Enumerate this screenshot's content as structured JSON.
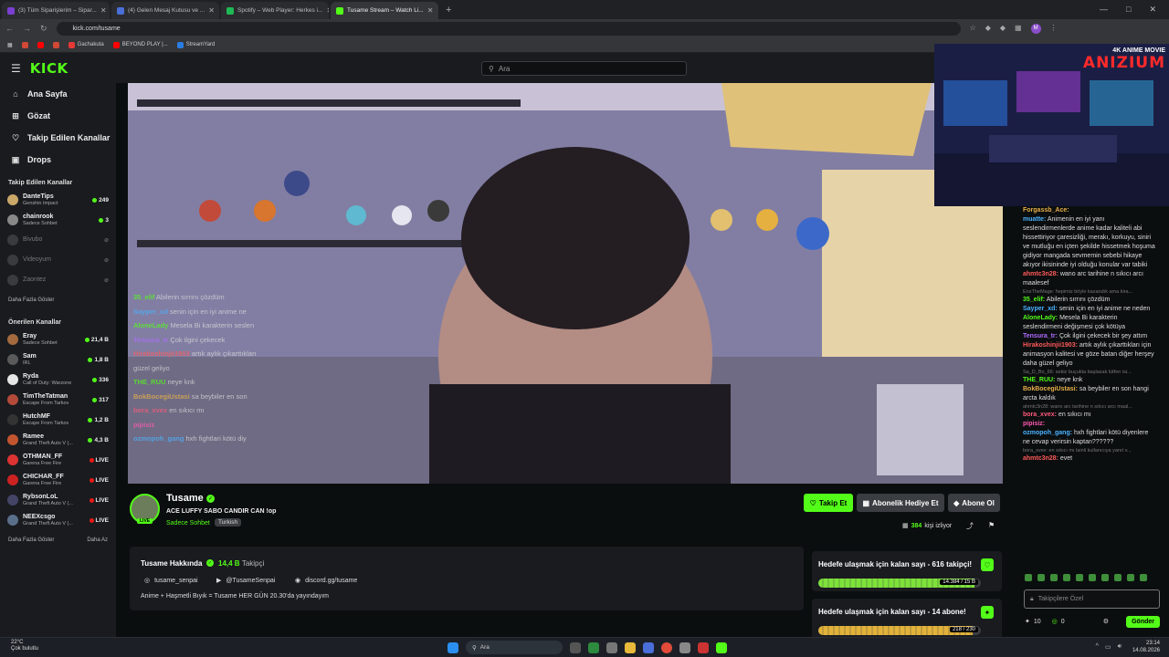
{
  "browser": {
    "tabs": [
      {
        "label": "(3) Tüm Siparişlerim – Sipar...",
        "color": "#7a3fd1",
        "active": false
      },
      {
        "label": "(4) Gelen Mesaj Kutusu ve ...",
        "color": "#4a6fd8",
        "active": false
      },
      {
        "label": "Spotify – Web Player: Herkes i...",
        "color": "#1db954",
        "active": false
      },
      {
        "label": "Tusame Stream – Watch Li...",
        "color": "#53fc18",
        "active": true
      }
    ],
    "url": "kick.com/tusame",
    "bookmarks": [
      {
        "label": "",
        "color": "#d14836"
      },
      {
        "label": "",
        "color": "#ff0000"
      },
      {
        "label": "",
        "color": "#d14836"
      },
      {
        "label": "Gachakuta",
        "color": "#e53935"
      },
      {
        "label": "BEYOND PLAY |...",
        "color": "#ff0000"
      },
      {
        "label": "StreamYard",
        "color": "#2a7de1"
      }
    ],
    "profile_initial": "M"
  },
  "header": {
    "logo": "KICK",
    "search_placeholder": "Ara"
  },
  "sidebar": {
    "nav": [
      {
        "label": "Ana Sayfa",
        "icon": "home-icon",
        "glyph": "⌂"
      },
      {
        "label": "Gözat",
        "icon": "browse-icon",
        "glyph": "⊞"
      },
      {
        "label": "Takip Edilen Kanallar",
        "icon": "heart-icon",
        "glyph": "♡"
      },
      {
        "label": "Drops",
        "icon": "gift-icon",
        "glyph": "▣"
      }
    ],
    "followed_title": "Takip Edilen Kanallar",
    "followed": [
      {
        "name": "DanteTips",
        "game": "Genshin Impact",
        "viewers": "249",
        "online": true,
        "color": "#c9a86a"
      },
      {
        "name": "chainrook",
        "game": "Sadece Sohbet",
        "viewers": "3",
        "online": true,
        "color": "#888"
      },
      {
        "name": "Bivubo",
        "game": "",
        "viewers": "",
        "online": false,
        "color": "#777"
      },
      {
        "name": "Videoyum",
        "game": "",
        "viewers": "",
        "online": false,
        "color": "#777"
      },
      {
        "name": "Zaontez",
        "game": "",
        "viewers": "",
        "online": false,
        "color": "#777"
      }
    ],
    "more_label": "Daha Fazla Göster",
    "recommended_title": "Önerilen Kanallar",
    "recommended": [
      {
        "name": "Eray",
        "game": "Sadece Sohbet",
        "viewers": "21,4 B",
        "color": "#a36a3e"
      },
      {
        "name": "Sam",
        "game": "IRL",
        "viewers": "1,8 B",
        "color": "#5a5a5a"
      },
      {
        "name": "Ryda",
        "game": "Call of Duty: Warzone",
        "viewers": "336",
        "color": "#e6e6e6"
      },
      {
        "name": "TimTheTatman",
        "game": "Escape From Tarkov",
        "viewers": "317",
        "color": "#b34a3a"
      },
      {
        "name": "HutchMF",
        "game": "Escape From Tarkov",
        "viewers": "1,2 B",
        "color": "#333"
      },
      {
        "name": "Ramee",
        "game": "Grand Theft Auto V (...",
        "viewers": "4,3 B",
        "color": "#c2552f"
      },
      {
        "name": "OTHMAN_FF",
        "game": "Garena Free Fire",
        "viewers": "LIVE",
        "color": "#d33"
      },
      {
        "name": "CHICHAR_FF",
        "game": "Garena Free Fire",
        "viewers": "LIVE",
        "color": "#c22"
      },
      {
        "name": "RybsonLoL",
        "game": "Grand Theft Auto V (...",
        "viewers": "LIVE",
        "color": "#446"
      },
      {
        "name": "NEEXcsgo",
        "game": "Grand Theft Auto V (...",
        "viewers": "LIVE",
        "color": "#5a6f8a"
      }
    ],
    "more_label2": "Daha Fazla Göster",
    "sort_label": "Daha Az"
  },
  "video": {
    "overlay_chat": [
      {
        "name": "35_elif",
        "text": "Abilerin sırrını çözdüm",
        "color": "#53fc18"
      },
      {
        "name": "Sayper_xd",
        "text": "senin için en iyi anime ne",
        "color": "#4ab3ff"
      },
      {
        "name": "AloneLady",
        "text": "Mesela Bi karakterin seslen",
        "color": "#53fc18"
      },
      {
        "name": "Tensura_tr",
        "text": "Çok ilgini çekecek",
        "color": "#b06bff"
      },
      {
        "name": "Hirakoshinjii1903",
        "text": "artık aylık çıkarttıkları",
        "color": "#ff5a5a"
      },
      {
        "name": "",
        "text": "güzel geliyo",
        "color": "#ddd"
      },
      {
        "name": "THE_RUU",
        "text": "neye knk",
        "color": "#53fc18"
      },
      {
        "name": "BokBocegiUstasi",
        "text": "sa beybiler en son",
        "color": "#e8b04a"
      },
      {
        "name": "bora_xvex",
        "text": "en sıkıcı mı",
        "color": "#ff5a7a"
      },
      {
        "name": "pipisiz",
        "text": "",
        "color": "#ff5ab0"
      },
      {
        "name": "ozmopoh_gang",
        "text": "hxh fightlari kötü diy",
        "color": "#4ab3ff"
      }
    ]
  },
  "cam": {
    "badge_top": "4K ANIME MOVIE",
    "badge_name": "ANIZIUM"
  },
  "channel": {
    "name": "Tusame",
    "title": "ACE LUFFY SABO CANDIR CAN !op",
    "category": "Sadece Sohbet",
    "language": "Turkish",
    "live_badge": "LIVE",
    "follow_label": "Takip Et",
    "gift_label": "Abonelik Hediye Et",
    "subscribe_label": "Abone Ol",
    "viewers": "384",
    "viewers_label": "kişi izliyor"
  },
  "about": {
    "title": "Tusame Hakkında",
    "followers": "14,4 B",
    "followers_label": "Takipçi",
    "socials": [
      {
        "icon": "instagram-icon",
        "glyph": "◎",
        "label": "tusame_senpai"
      },
      {
        "icon": "youtube-icon",
        "glyph": "▶",
        "label": "@TusameSenpai"
      },
      {
        "icon": "discord-icon",
        "glyph": "◉",
        "label": "discord.gg/tusame"
      }
    ],
    "bio": "Anime + Haşmetli Bıyık = Tusame HER GÜN 20.30'da yayındayım"
  },
  "goals": [
    {
      "title": "Hedefe ulaşmak için kalan sayı - 616 takipçi!",
      "current": 14384,
      "target": 15000,
      "label": "14.384 / 15 B",
      "color": "#7ee23a"
    },
    {
      "title": "Hedefe ulaşmak için kalan sayı - 14 abone!",
      "current": 218,
      "target": 230,
      "label": "218 / 230",
      "color": "#e2b23a"
    }
  ],
  "chat": {
    "messages": [
      {
        "kind": "msg",
        "name": "Forgassb_Ace:",
        "text": "",
        "color": "#e8b04a"
      },
      {
        "kind": "msg",
        "name": "muatte:",
        "text": "Animenin en iyi yanı seslendirmenlerde anime kadar kaliteli abi hissettiriyor çaresizliği, merakı, korkuyu, siniri ve mutluğu en içten şekilde hissetmek hoşuma gidiyor mangada sevmemin sebebi hikaye akıyor ikisininde iyi olduğu konular var tabiki",
        "color": "#4ab3ff"
      },
      {
        "kind": "msg",
        "name": "ahmtc3n28:",
        "text": "wano arc tarihine n sıkıcı arcı maalesef",
        "color": "#ff5a5a"
      },
      {
        "kind": "reply",
        "text": "EnsTheMage: hepimiz böyle kazandık ama kira..."
      },
      {
        "kind": "msg",
        "name": "35_elif:",
        "text": "Abilerin sırrını çözdüm",
        "color": "#53fc18"
      },
      {
        "kind": "msg",
        "name": "Sayper_xd:",
        "text": "senin için en iyi anime ne neden",
        "color": "#4ab3ff"
      },
      {
        "kind": "msg",
        "name": "AloneLady:",
        "text": "Mesela Bi karakterin seslendirmeni değişmesi çok kötüya",
        "color": "#53fc18"
      },
      {
        "kind": "msg",
        "name": "Tensura_tr:",
        "text": "Çok ilgini çekecek bir şey attım",
        "color": "#b06bff"
      },
      {
        "kind": "msg",
        "name": "Hirakoshinjii1903:",
        "text": "artık aylık çıkarttıkları için animasyon kalitesi ve göze batan diğer herşey daha güzel geliyo",
        "color": "#ff5a5a"
      },
      {
        "kind": "reply",
        "text": "Sa_D_Bo_66: sekiz buçukta başlasak lütfen isi..."
      },
      {
        "kind": "msg",
        "name": "THE_RUU:",
        "text": "neye knk",
        "color": "#53fc18"
      },
      {
        "kind": "msg",
        "name": "BokBocegiUstasi:",
        "text": "sa beybiler en son hangi arcta kaldık",
        "color": "#e8b04a"
      },
      {
        "kind": "reply",
        "text": "ahmtc3n28: wano arc tarihine n sıkıcı arcı maal..."
      },
      {
        "kind": "msg",
        "name": "bora_xvex:",
        "text": "en sıkıcı mı",
        "color": "#ff5a7a"
      },
      {
        "kind": "msg",
        "name": "pipisiz:",
        "text": "",
        "color": "#ff5ab0"
      },
      {
        "kind": "msg",
        "name": "ozmopoh_gang:",
        "text": "hxh fightlari kötü diyenlere ne cevap verirsin kaptan??????",
        "color": "#4ab3ff"
      },
      {
        "kind": "reply",
        "text": "bora_xvex: en sıkıcı mı lainli kullanıcıya yanıt v..."
      },
      {
        "kind": "msg",
        "name": "ahmtc3n28:",
        "text": "evet",
        "color": "#ff5a5a"
      }
    ],
    "input_placeholder": "Takipçilere Özel",
    "points": "10",
    "kicks": "0",
    "send_label": "Gönder"
  },
  "taskbar": {
    "temp": "22°C",
    "weather": "Çok bulutlu",
    "search_placeholder": "Ara",
    "time": "23:14",
    "date": "14.08.2026"
  }
}
